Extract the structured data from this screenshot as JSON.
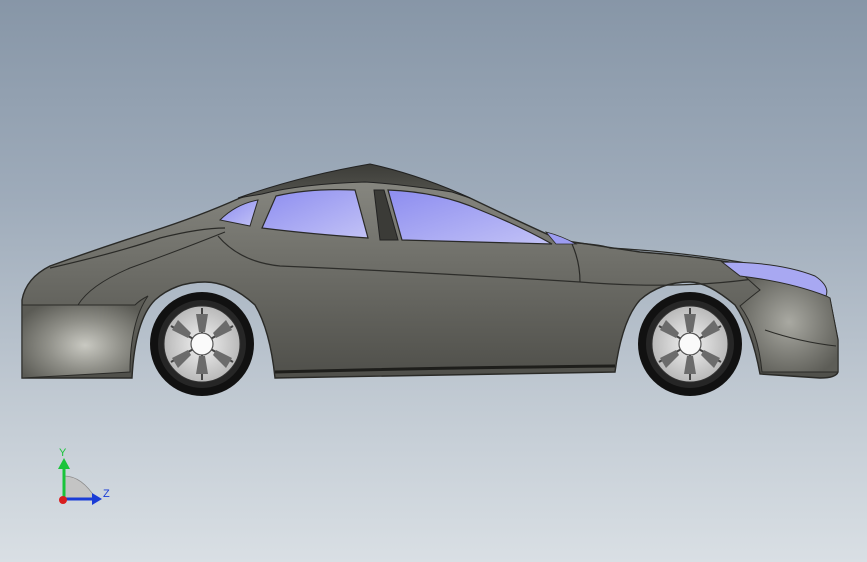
{
  "viewport": {
    "background_top": "#8796a7",
    "background_bottom": "#d9dfe4"
  },
  "model": {
    "body_color": "#6f6f69",
    "glass_color": "#a8a8f2"
  },
  "triad": {
    "y_label": "Y",
    "z_label": "Z",
    "y_color": "#19c43a",
    "z_color": "#1a3cd6",
    "x_color": "#d81e1e"
  }
}
